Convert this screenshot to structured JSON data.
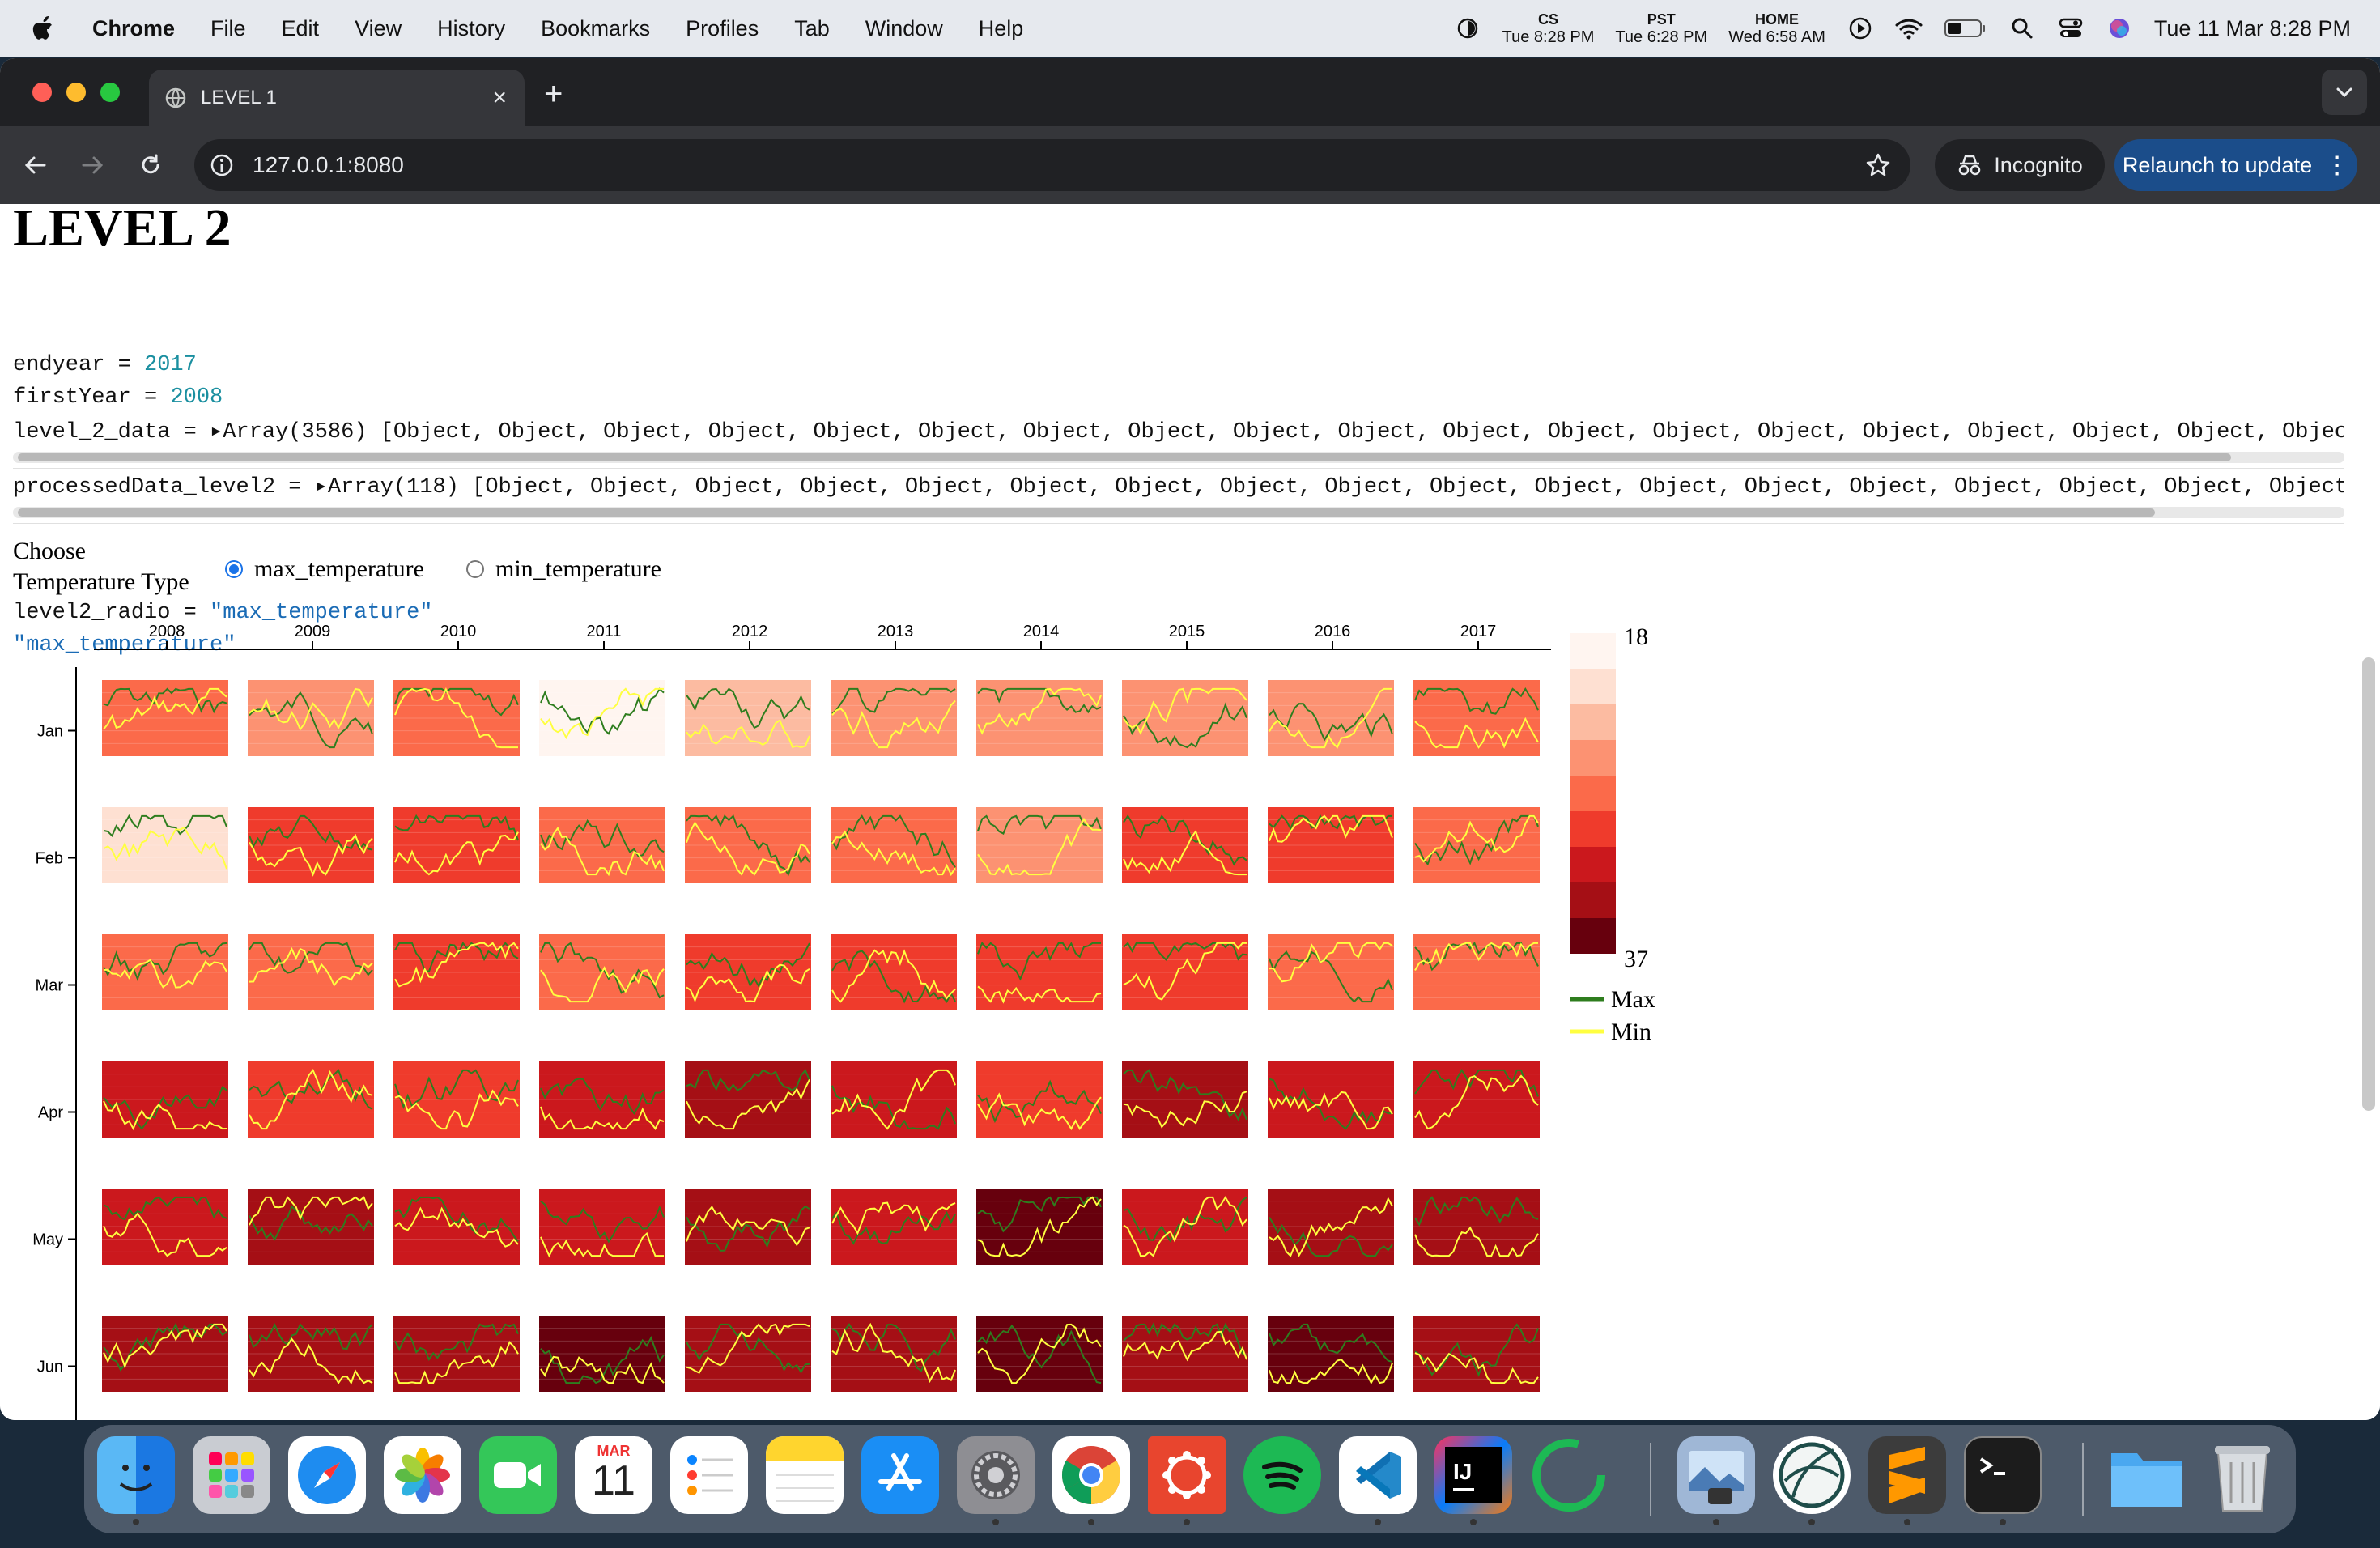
{
  "menubar": {
    "app": "Chrome",
    "items": [
      "File",
      "Edit",
      "View",
      "History",
      "Bookmarks",
      "Profiles",
      "Tab",
      "Window",
      "Help"
    ],
    "clocks": [
      {
        "label": "CS",
        "time": "Tue 8:28 PM"
      },
      {
        "label": "PST",
        "time": "Tue 6:28 PM"
      },
      {
        "label": "HOME",
        "time": "Wed 6:58 AM"
      }
    ],
    "datetime": "Tue 11 Mar  8:28 PM"
  },
  "browser": {
    "tab_title": "LEVEL 1",
    "url": "127.0.0.1:8080",
    "incognito_label": "Incognito",
    "relaunch_label": "Relaunch to update"
  },
  "page": {
    "heading": "LEVEL 2",
    "cells": {
      "endyear_name": "endyear = ",
      "endyear_value": "2017",
      "firstyear_name": "firstYear = ",
      "firstyear_value": "2008",
      "level2data": "level_2_data = ▸Array(3586) [Object, Object, Object, Object, Object, Object, Object, Object, Object, Object, Object, Object, Object, Object, Object, Object, Object, Object, Object, O",
      "processed": "processedData_level2 = ▸Array(118) [Object, Object, Object, Object, Object, Object, Object, Object, Object, Object, Object, Object, Object, Object, Object, Object, Object, Object, Object, Ob",
      "radio_name": "level2_radio = ",
      "radio_value": "\"max_temperature\"",
      "radio_echo": "\"max_temperature\""
    },
    "choose_label_1": "Choose",
    "choose_label_2": "Temperature Type",
    "radio_options": [
      {
        "label": "max_temperature",
        "selected": true
      },
      {
        "label": "min_temperature",
        "selected": false
      }
    ]
  },
  "chart_data": {
    "type": "heatmap",
    "x_categories": [
      "2008",
      "2009",
      "2010",
      "2011",
      "2012",
      "2013",
      "2014",
      "2015",
      "2016",
      "2017"
    ],
    "y_categories": [
      "Jan",
      "Feb",
      "Mar",
      "Apr",
      "May",
      "Jun"
    ],
    "cell_values_max_temperature": [
      [
        27,
        25,
        27,
        19,
        23,
        26,
        26,
        26,
        25,
        27
      ],
      [
        21,
        29,
        30,
        28,
        28,
        27,
        26,
        29,
        29,
        27
      ],
      [
        28,
        28,
        29,
        28,
        30,
        30,
        29,
        29,
        28,
        28
      ],
      [
        31,
        30,
        29,
        32,
        33,
        32,
        30,
        33,
        31,
        31
      ],
      [
        32,
        33,
        32,
        32,
        33,
        32,
        35,
        32,
        33,
        33
      ],
      [
        33,
        33,
        33,
        35,
        33,
        34,
        35,
        34,
        35,
        33
      ]
    ],
    "color_scale": {
      "min": 18,
      "max": 37,
      "min_label": "18",
      "max_label": "37",
      "colors": [
        "#fff5f0",
        "#fee0d2",
        "#fcbba1",
        "#fc9272",
        "#fb6a4a",
        "#ef3b2c",
        "#cb181d",
        "#a50f15",
        "#67000d"
      ]
    },
    "legend": [
      {
        "name": "Max",
        "color": "#2e7d1e"
      },
      {
        "name": "Min",
        "color": "#ffff40"
      }
    ]
  },
  "dock": {
    "icons": [
      "finder-icon",
      "launchpad-icon",
      "safari-icon",
      "photos-icon",
      "facetime-icon",
      "calendar-icon",
      "reminders-icon",
      "notes-icon",
      "app-store-icon",
      "system-settings-icon",
      "chrome-icon",
      "cisco-icon",
      "spotify-icon",
      "vscode-icon",
      "intellij-icon",
      "activity-icon",
      "preview-icon",
      "disk-utility-icon",
      "sublime-text-icon",
      "terminal-icon",
      "folder-icon",
      "trash-icon"
    ],
    "calendar_month": "MAR",
    "calendar_day": "11",
    "intellij_text": "IJ"
  }
}
